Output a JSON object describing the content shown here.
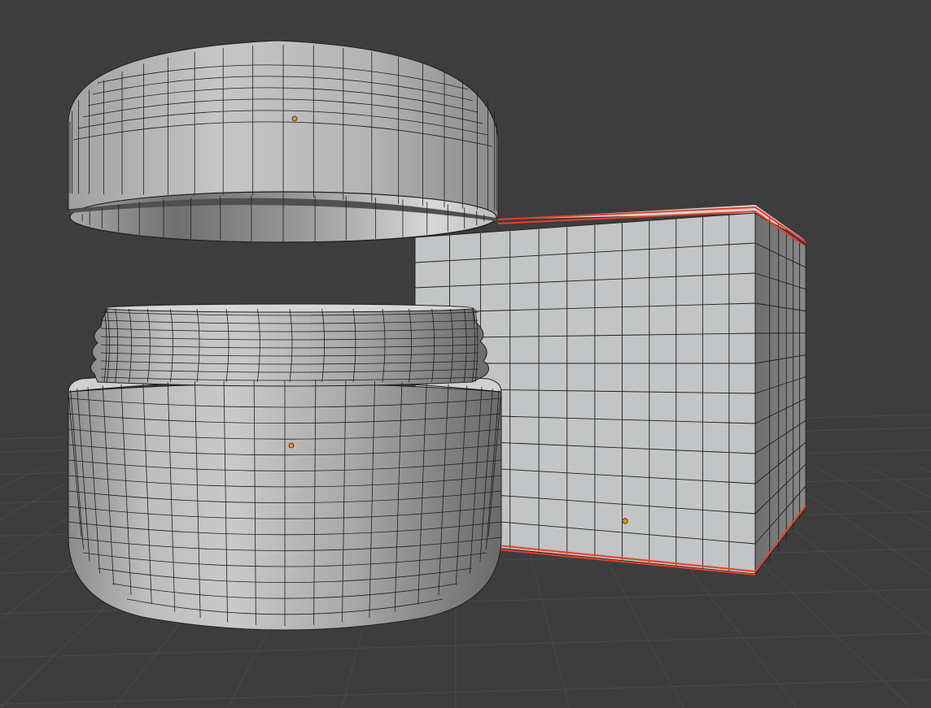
{
  "app": "3D viewport",
  "viewport": {
    "background_color": "#3d3d3d",
    "grid_color": "#4a4a4a",
    "wire_color": "#1e1e1e",
    "selection_outline_color": "#e8402a",
    "origin_dot_color": "#f08a24",
    "objects": [
      {
        "name": "jar-lid",
        "shape": "cylinder-cap",
        "state": "unselected"
      },
      {
        "name": "jar-body",
        "shape": "threaded-cylinder",
        "state": "unselected"
      },
      {
        "name": "cube",
        "shape": "subdivided-cube",
        "state": "selected"
      }
    ]
  }
}
